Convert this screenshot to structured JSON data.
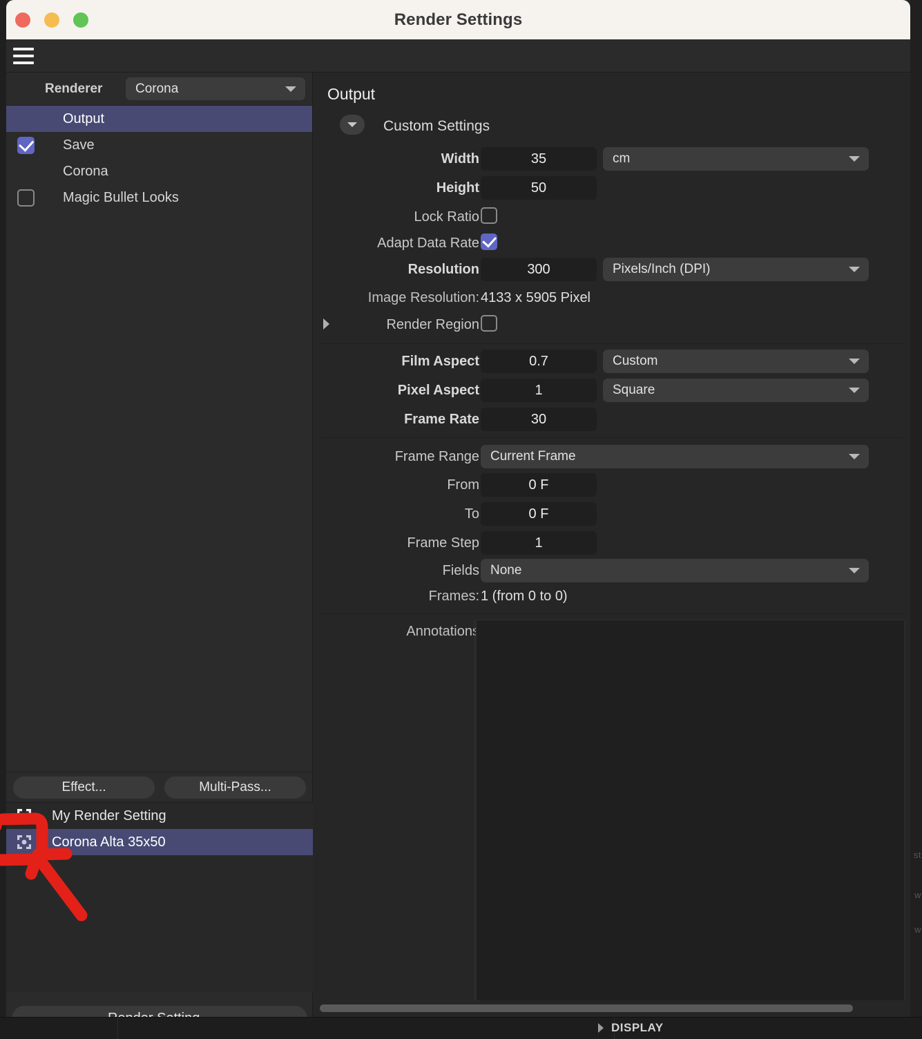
{
  "window": {
    "title": "Render Settings",
    "traffic_lights": [
      "close-button",
      "minimize-button",
      "zoom-button"
    ]
  },
  "toolbar": {
    "menu_icon": "hamburger-menu-icon"
  },
  "left_panel": {
    "renderer": {
      "label": "Renderer",
      "value": "Corona"
    },
    "nav_items": [
      {
        "label": "Output",
        "checkbox": "none",
        "selected": true
      },
      {
        "label": "Save",
        "checkbox": "on",
        "selected": false
      },
      {
        "label": "Corona",
        "checkbox": "none",
        "selected": false
      },
      {
        "label": "Magic Bullet Looks",
        "checkbox": "off",
        "selected": false
      }
    ],
    "buttons": {
      "effect": "Effect...",
      "multi_pass": "Multi-Pass...",
      "render_setting": "Render Setting..."
    },
    "presets": [
      {
        "label": "My Render Setting",
        "selected": false
      },
      {
        "label": "Corona Alta 35x50",
        "selected": true
      }
    ]
  },
  "main_panel": {
    "section_title": "Output",
    "custom_settings_label": "Custom Settings",
    "fields": {
      "width": {
        "label": "Width",
        "value": "35",
        "unit": "cm"
      },
      "height": {
        "label": "Height",
        "value": "50"
      },
      "lock_ratio": {
        "label": "Lock Ratio",
        "checked": "off"
      },
      "adapt_data_rate": {
        "label": "Adapt Data Rate",
        "checked": "on"
      },
      "resolution": {
        "label": "Resolution",
        "value": "300",
        "unit": "Pixels/Inch (DPI)"
      },
      "image_resolution": {
        "label": "Image Resolution:",
        "value": "4133 x 5905 Pixel"
      },
      "render_region": {
        "label": "Render Region",
        "checked": "off"
      },
      "film_aspect": {
        "label": "Film Aspect",
        "value": "0.7",
        "preset": "Custom"
      },
      "pixel_aspect": {
        "label": "Pixel Aspect",
        "value": "1",
        "preset": "Square"
      },
      "frame_rate": {
        "label": "Frame Rate",
        "value": "30"
      },
      "frame_range": {
        "label": "Frame Range",
        "value": "Current Frame"
      },
      "from": {
        "label": "From",
        "value": "0 F"
      },
      "to": {
        "label": "To",
        "value": "0 F"
      },
      "frame_step": {
        "label": "Frame Step",
        "value": "1"
      },
      "fields": {
        "label": "Fields",
        "value": "None"
      },
      "frames": {
        "label": "Frames:",
        "value": "1 (from 0 to 0)"
      },
      "annotations": {
        "label": "Annotations",
        "value": ""
      }
    }
  },
  "bottom_bar": {
    "display_label": "DISPLAY"
  },
  "behind_window": {
    "ghost_1": "st",
    "ghost_2": "w",
    "ghost_3": "w"
  },
  "colors": {
    "accent_purple": "#484a74",
    "checkbox_blue": "#6066c4",
    "panel_bg": "#2b2b2b",
    "main_bg": "#262626",
    "titlebar_bg": "#f6f3ef",
    "annotation_red": "#e32119"
  }
}
